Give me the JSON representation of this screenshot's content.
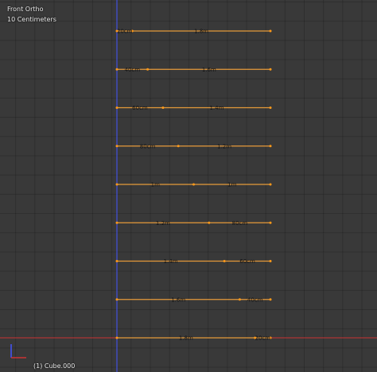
{
  "viewport": {
    "view_title": "Front Ortho",
    "unit_label": "10 Centimeters",
    "object_label": "(1) Cube.000"
  },
  "colors": {
    "background": "#393939",
    "edge": "#e69a3a",
    "vertex": "#ff9a1a",
    "z_axis": "#4455ff",
    "x_axis": "#cc3333"
  },
  "icons": [
    "axis-gizmo-icon"
  ],
  "edges": [
    {
      "left_label": "20cm",
      "right_label": "1.8m",
      "split_fraction": 0.1
    },
    {
      "left_label": "40cm",
      "right_label": "1.6m",
      "split_fraction": 0.2
    },
    {
      "left_label": "60cm",
      "right_label": "1.4m",
      "split_fraction": 0.3
    },
    {
      "left_label": "80cm",
      "right_label": "1.2m",
      "split_fraction": 0.4
    },
    {
      "left_label": "1m",
      "right_label": "1m",
      "split_fraction": 0.5
    },
    {
      "left_label": "1.2m",
      "right_label": "80cm",
      "split_fraction": 0.6
    },
    {
      "left_label": "1.4m",
      "right_label": "60cm",
      "split_fraction": 0.7
    },
    {
      "left_label": "1.6m",
      "right_label": "40cm",
      "split_fraction": 0.8
    },
    {
      "left_label": "1.8m",
      "right_label": "20cm",
      "split_fraction": 0.9
    }
  ]
}
